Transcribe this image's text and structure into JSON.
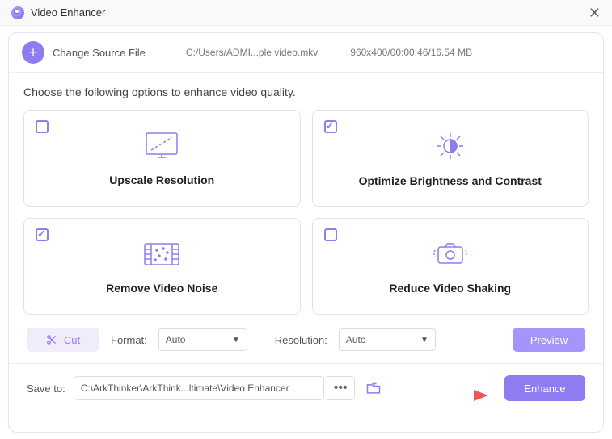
{
  "title": "Video Enhancer",
  "source": {
    "changeLabel": "Change Source File",
    "path": "C:/Users/ADMI...ple video.mkv",
    "info": "960x400/00:00:46/16.54 MB"
  },
  "prompt": "Choose the following options to enhance video quality.",
  "options": [
    {
      "label": "Upscale Resolution",
      "checked": false,
      "icon": "monitor-upscale-icon"
    },
    {
      "label": "Optimize Brightness and Contrast",
      "checked": true,
      "icon": "brightness-sun-icon"
    },
    {
      "label": "Remove Video Noise",
      "checked": true,
      "icon": "film-noise-icon"
    },
    {
      "label": "Reduce Video Shaking",
      "checked": false,
      "icon": "camera-stabilize-icon"
    }
  ],
  "controls": {
    "cutLabel": "Cut",
    "formatLabel": "Format:",
    "formatValue": "Auto",
    "resolutionLabel": "Resolution:",
    "resolutionValue": "Auto",
    "previewLabel": "Preview"
  },
  "save": {
    "label": "Save to:",
    "path": "C:\\ArkThinker\\ArkThink...ltimate\\Video Enhancer",
    "enhanceLabel": "Enhance"
  },
  "colors": {
    "accent": "#8e7cf0",
    "accentLight": "#a594f9"
  }
}
